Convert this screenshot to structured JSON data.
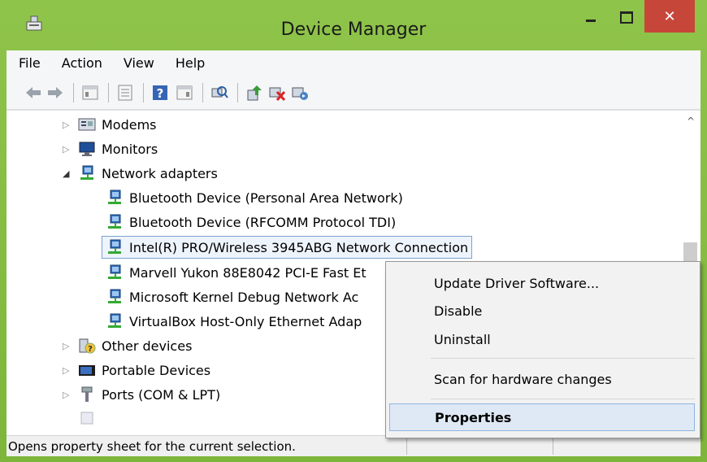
{
  "window": {
    "title": "Device Manager",
    "close_glyph": "✕"
  },
  "menubar": [
    "File",
    "Action",
    "View",
    "Help"
  ],
  "toolbar": {
    "icons": [
      "back-arrow-icon",
      "forward-arrow-icon",
      "show-hide-console-tree-icon",
      "properties-icon",
      "help-icon",
      "action-pane-icon",
      "scan-hardware-icon",
      "update-driver-icon",
      "uninstall-icon",
      "enable-device-icon"
    ]
  },
  "tree": {
    "nodes": [
      {
        "label": "Modems",
        "expander": "▷",
        "icon": "modem-icon"
      },
      {
        "label": "Monitors",
        "expander": "▷",
        "icon": "monitor-icon"
      },
      {
        "label": "Network adapters",
        "expander": "◢",
        "icon": "network-adapter-icon"
      },
      {
        "label": "Bluetooth Device (Personal Area Network)",
        "icon": "network-adapter-icon"
      },
      {
        "label": "Bluetooth Device (RFCOMM Protocol TDI)",
        "icon": "network-adapter-icon"
      },
      {
        "label": "Intel(R) PRO/Wireless 3945ABG Network Connection",
        "icon": "network-adapter-icon"
      },
      {
        "label": "Marvell Yukon 88E8042 PCI-E Fast Et",
        "icon": "network-adapter-icon"
      },
      {
        "label": "Microsoft Kernel Debug Network Ac",
        "icon": "network-adapter-icon"
      },
      {
        "label": "VirtualBox Host-Only Ethernet Adap",
        "icon": "network-adapter-icon"
      },
      {
        "label": "Other devices",
        "expander": "▷",
        "icon": "unknown-device-icon"
      },
      {
        "label": "Portable Devices",
        "expander": "▷",
        "icon": "portable-device-icon"
      },
      {
        "label": "Ports (COM & LPT)",
        "expander": "▷",
        "icon": "port-icon"
      }
    ],
    "scroll_up_glyph": "^"
  },
  "context_menu": {
    "items": [
      "Update Driver Software...",
      "Disable",
      "Uninstall",
      "Scan for hardware changes",
      "Properties"
    ]
  },
  "statusbar": {
    "text": "Opens property sheet for the current selection."
  },
  "colors": {
    "close_button": "#c7463a",
    "selection_border": "#7da2ce",
    "menu_highlight": "#dfe9f6"
  }
}
